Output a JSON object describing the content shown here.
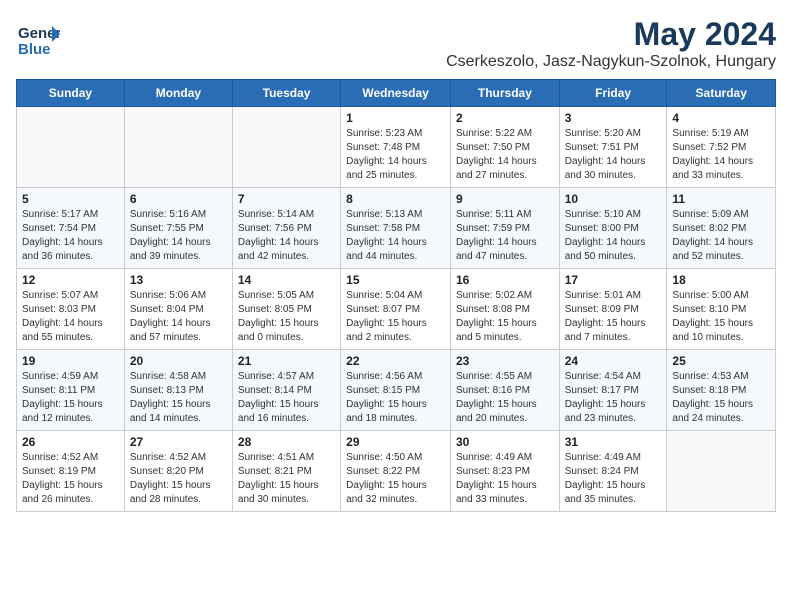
{
  "header": {
    "logo_line1": "General",
    "logo_line2": "Blue",
    "month": "May 2024",
    "location": "Cserkeszolo, Jasz-Nagykun-Szolnok, Hungary"
  },
  "days_of_week": [
    "Sunday",
    "Monday",
    "Tuesday",
    "Wednesday",
    "Thursday",
    "Friday",
    "Saturday"
  ],
  "weeks": [
    [
      {
        "day": "",
        "info": ""
      },
      {
        "day": "",
        "info": ""
      },
      {
        "day": "",
        "info": ""
      },
      {
        "day": "1",
        "info": "Sunrise: 5:23 AM\nSunset: 7:48 PM\nDaylight: 14 hours\nand 25 minutes."
      },
      {
        "day": "2",
        "info": "Sunrise: 5:22 AM\nSunset: 7:50 PM\nDaylight: 14 hours\nand 27 minutes."
      },
      {
        "day": "3",
        "info": "Sunrise: 5:20 AM\nSunset: 7:51 PM\nDaylight: 14 hours\nand 30 minutes."
      },
      {
        "day": "4",
        "info": "Sunrise: 5:19 AM\nSunset: 7:52 PM\nDaylight: 14 hours\nand 33 minutes."
      }
    ],
    [
      {
        "day": "5",
        "info": "Sunrise: 5:17 AM\nSunset: 7:54 PM\nDaylight: 14 hours\nand 36 minutes."
      },
      {
        "day": "6",
        "info": "Sunrise: 5:16 AM\nSunset: 7:55 PM\nDaylight: 14 hours\nand 39 minutes."
      },
      {
        "day": "7",
        "info": "Sunrise: 5:14 AM\nSunset: 7:56 PM\nDaylight: 14 hours\nand 42 minutes."
      },
      {
        "day": "8",
        "info": "Sunrise: 5:13 AM\nSunset: 7:58 PM\nDaylight: 14 hours\nand 44 minutes."
      },
      {
        "day": "9",
        "info": "Sunrise: 5:11 AM\nSunset: 7:59 PM\nDaylight: 14 hours\nand 47 minutes."
      },
      {
        "day": "10",
        "info": "Sunrise: 5:10 AM\nSunset: 8:00 PM\nDaylight: 14 hours\nand 50 minutes."
      },
      {
        "day": "11",
        "info": "Sunrise: 5:09 AM\nSunset: 8:02 PM\nDaylight: 14 hours\nand 52 minutes."
      }
    ],
    [
      {
        "day": "12",
        "info": "Sunrise: 5:07 AM\nSunset: 8:03 PM\nDaylight: 14 hours\nand 55 minutes."
      },
      {
        "day": "13",
        "info": "Sunrise: 5:06 AM\nSunset: 8:04 PM\nDaylight: 14 hours\nand 57 minutes."
      },
      {
        "day": "14",
        "info": "Sunrise: 5:05 AM\nSunset: 8:05 PM\nDaylight: 15 hours\nand 0 minutes."
      },
      {
        "day": "15",
        "info": "Sunrise: 5:04 AM\nSunset: 8:07 PM\nDaylight: 15 hours\nand 2 minutes."
      },
      {
        "day": "16",
        "info": "Sunrise: 5:02 AM\nSunset: 8:08 PM\nDaylight: 15 hours\nand 5 minutes."
      },
      {
        "day": "17",
        "info": "Sunrise: 5:01 AM\nSunset: 8:09 PM\nDaylight: 15 hours\nand 7 minutes."
      },
      {
        "day": "18",
        "info": "Sunrise: 5:00 AM\nSunset: 8:10 PM\nDaylight: 15 hours\nand 10 minutes."
      }
    ],
    [
      {
        "day": "19",
        "info": "Sunrise: 4:59 AM\nSunset: 8:11 PM\nDaylight: 15 hours\nand 12 minutes."
      },
      {
        "day": "20",
        "info": "Sunrise: 4:58 AM\nSunset: 8:13 PM\nDaylight: 15 hours\nand 14 minutes."
      },
      {
        "day": "21",
        "info": "Sunrise: 4:57 AM\nSunset: 8:14 PM\nDaylight: 15 hours\nand 16 minutes."
      },
      {
        "day": "22",
        "info": "Sunrise: 4:56 AM\nSunset: 8:15 PM\nDaylight: 15 hours\nand 18 minutes."
      },
      {
        "day": "23",
        "info": "Sunrise: 4:55 AM\nSunset: 8:16 PM\nDaylight: 15 hours\nand 20 minutes."
      },
      {
        "day": "24",
        "info": "Sunrise: 4:54 AM\nSunset: 8:17 PM\nDaylight: 15 hours\nand 23 minutes."
      },
      {
        "day": "25",
        "info": "Sunrise: 4:53 AM\nSunset: 8:18 PM\nDaylight: 15 hours\nand 24 minutes."
      }
    ],
    [
      {
        "day": "26",
        "info": "Sunrise: 4:52 AM\nSunset: 8:19 PM\nDaylight: 15 hours\nand 26 minutes."
      },
      {
        "day": "27",
        "info": "Sunrise: 4:52 AM\nSunset: 8:20 PM\nDaylight: 15 hours\nand 28 minutes."
      },
      {
        "day": "28",
        "info": "Sunrise: 4:51 AM\nSunset: 8:21 PM\nDaylight: 15 hours\nand 30 minutes."
      },
      {
        "day": "29",
        "info": "Sunrise: 4:50 AM\nSunset: 8:22 PM\nDaylight: 15 hours\nand 32 minutes."
      },
      {
        "day": "30",
        "info": "Sunrise: 4:49 AM\nSunset: 8:23 PM\nDaylight: 15 hours\nand 33 minutes."
      },
      {
        "day": "31",
        "info": "Sunrise: 4:49 AM\nSunset: 8:24 PM\nDaylight: 15 hours\nand 35 minutes."
      },
      {
        "day": "",
        "info": ""
      }
    ]
  ]
}
